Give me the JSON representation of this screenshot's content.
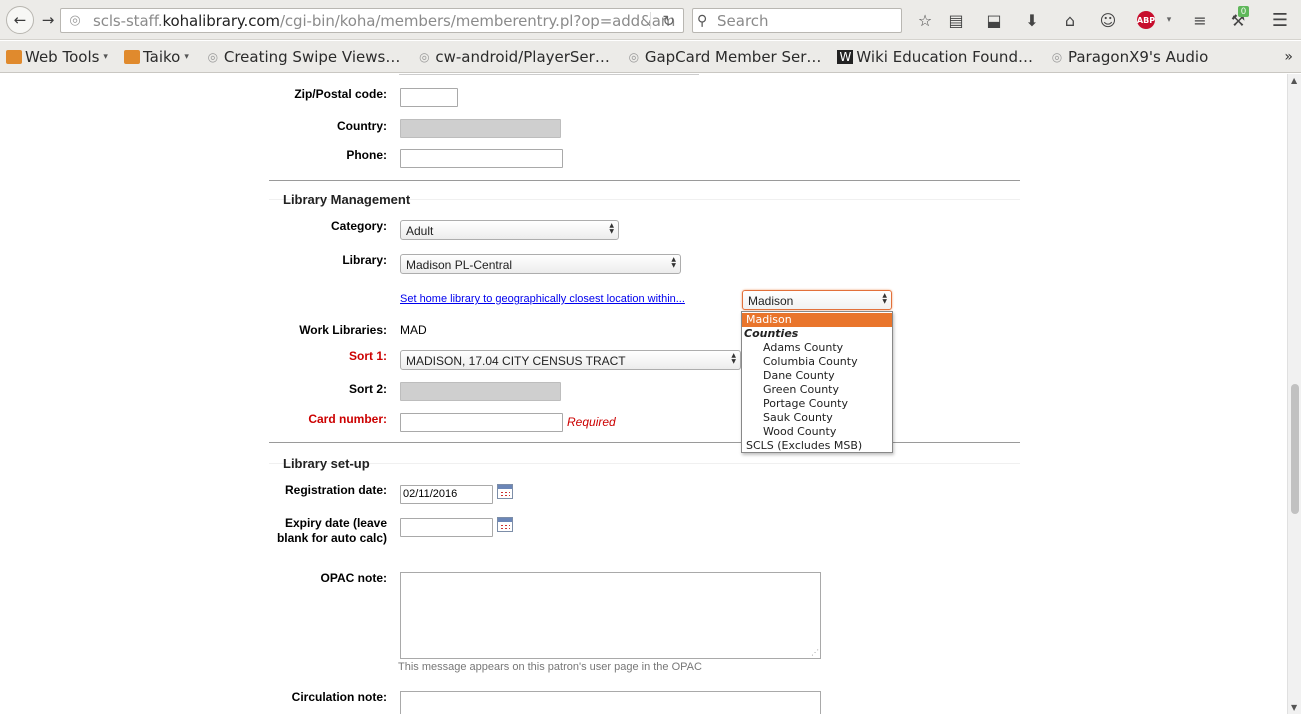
{
  "browser": {
    "url_prefix": "scls-staff.",
    "url_domain": "kohalibrary.com",
    "url_path": "/cgi-bin/koha/members/memberentry.pl?op=add&am",
    "search_placeholder": "Search",
    "abp_label": "ABP",
    "badge_count": "0",
    "bookmarks": [
      {
        "label": "Web Tools",
        "type": "folder"
      },
      {
        "label": "Taiko",
        "type": "folder"
      },
      {
        "label": "Creating Swipe Views…",
        "type": "globe"
      },
      {
        "label": "cw-android/PlayerSer…",
        "type": "globe"
      },
      {
        "label": "GapCard Member Ser…",
        "type": "globe"
      },
      {
        "label": "Wiki Education Found…",
        "type": "wiki"
      },
      {
        "label": "ParagonX9's Audio",
        "type": "globe"
      }
    ]
  },
  "form": {
    "address": {
      "zip_label": "Zip/Postal code:",
      "country_label": "Country:",
      "phone_label": "Phone:"
    },
    "library_management": {
      "legend": "Library Management",
      "category_label": "Category:",
      "category_value": "Adult",
      "library_label": "Library:",
      "library_value": "Madison PL-Central",
      "geo_link": "Set home library to geographically closest location within...",
      "geo_select_value": "Madison",
      "work_libraries_label": "Work Libraries:",
      "work_libraries_value": "MAD",
      "sort1_label": "Sort 1:",
      "sort1_value": "MADISON, 17.04 CITY CENSUS TRACT",
      "sort2_label": "Sort 2:",
      "card_label": "Card number:",
      "required_text": "Required"
    },
    "library_setup": {
      "legend": "Library set-up",
      "registration_label": "Registration date:",
      "registration_value": "02/11/2016",
      "expiry_label": "Expiry date (leave blank for auto calc)",
      "opac_note_label": "OPAC note:",
      "opac_hint": "This message appears on this patron's user page in the OPAC",
      "circ_note_label": "Circulation note:"
    }
  },
  "dropdown": {
    "selected": "Madison",
    "group_label": "Counties",
    "counties": [
      "Adams County",
      "Columbia County",
      "Dane County",
      "Green County",
      "Portage County",
      "Sauk County",
      "Wood County"
    ],
    "last": "SCLS (Excludes MSB)"
  },
  "colors": {
    "accent_orange": "#e9752c",
    "required_red": "#cc0000",
    "link_blue": "#0000ee"
  }
}
